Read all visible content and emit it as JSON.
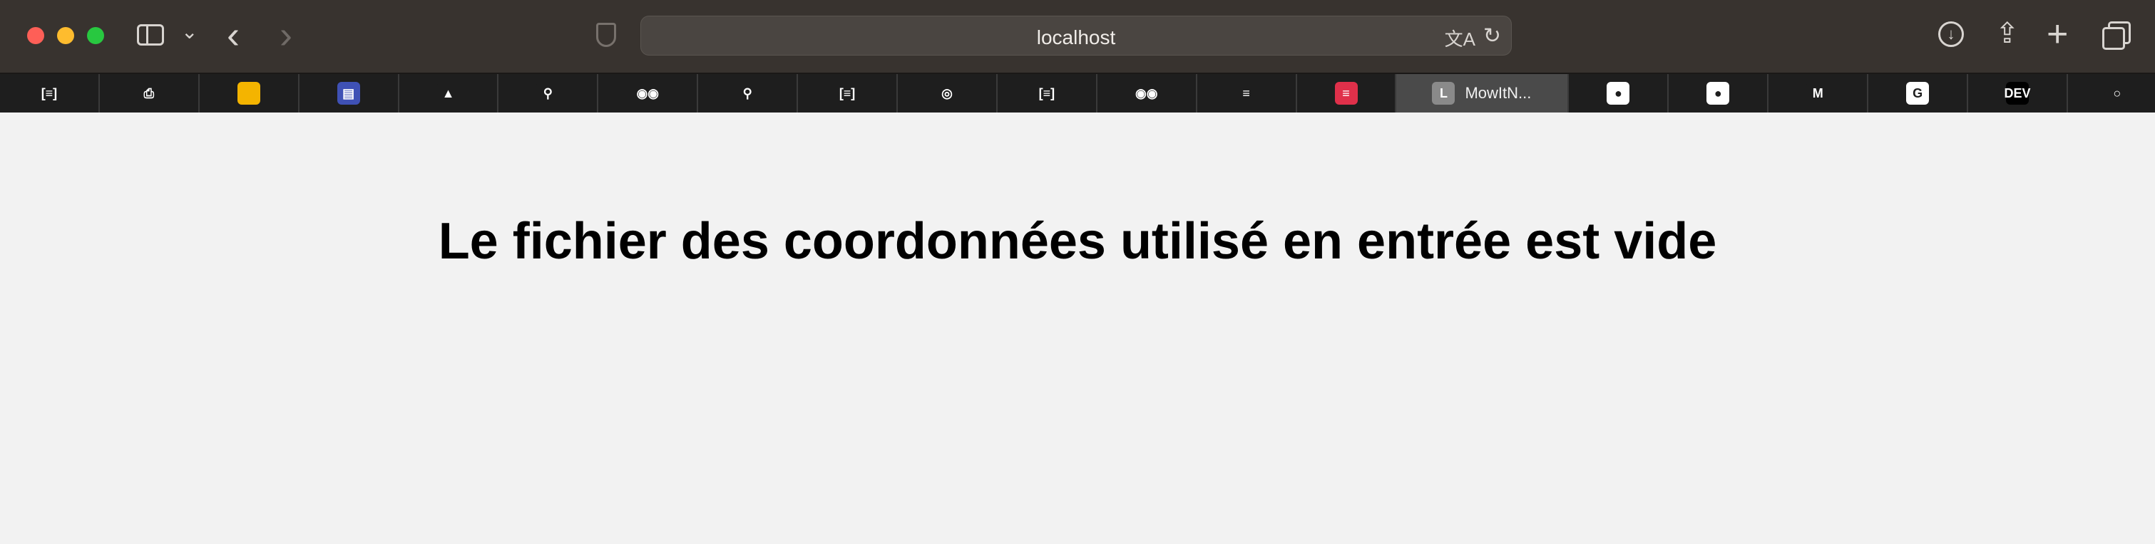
{
  "browser": {
    "url": "localhost",
    "tabs": [
      {
        "icon": "reader-icon",
        "glyph": "[≡]",
        "color": "#1e1e1e"
      },
      {
        "icon": "printer-icon",
        "glyph": "⎙",
        "color": "#1e1e1e"
      },
      {
        "icon": "slides-icon",
        "glyph": "",
        "color": "#f4b400"
      },
      {
        "icon": "calendar-app-icon",
        "glyph": "▤",
        "color": "#3f51b5"
      },
      {
        "icon": "google-drive-icon",
        "glyph": "▲",
        "color": "#1e1e1e"
      },
      {
        "icon": "location-pin-icon",
        "glyph": "⚲",
        "color": "#1e1e1e"
      },
      {
        "icon": "eyes-icon",
        "glyph": "◉◉",
        "color": "#1e1e1e"
      },
      {
        "icon": "location-pin-icon",
        "glyph": "⚲",
        "color": "#1e1e1e"
      },
      {
        "icon": "reader-icon",
        "glyph": "[≡]",
        "color": "#1e1e1e"
      },
      {
        "icon": "green-circle-icon",
        "glyph": "◎",
        "color": "#1e1e1e"
      },
      {
        "icon": "reader-icon",
        "glyph": "[≡]",
        "color": "#1e1e1e"
      },
      {
        "icon": "eyes-icon",
        "glyph": "◉◉",
        "color": "#1e1e1e"
      },
      {
        "icon": "stack-overflow-icon",
        "glyph": "≡",
        "color": "#1e1e1e"
      },
      {
        "icon": "red-reader-icon",
        "glyph": "≡",
        "color": "#e0304a"
      },
      {
        "icon": "letter-l-icon",
        "glyph": "L",
        "color": "#8a8a8a",
        "label": "MowItN...",
        "active": true
      },
      {
        "icon": "github-icon",
        "glyph": "●",
        "color": "#ffffff"
      },
      {
        "icon": "github-icon",
        "glyph": "●",
        "color": "#ffffff"
      },
      {
        "icon": "gmail-icon",
        "glyph": "M",
        "color": "#1e1e1e"
      },
      {
        "icon": "google-icon",
        "glyph": "G",
        "color": "#ffffff"
      },
      {
        "icon": "dev-icon",
        "glyph": "DEV",
        "color": "#000000"
      },
      {
        "icon": "circle-app-icon",
        "glyph": "○",
        "color": "#1e1e1e"
      }
    ]
  },
  "page": {
    "heading": "Le fichier des coordonnées utilisé en entrée est vide"
  }
}
